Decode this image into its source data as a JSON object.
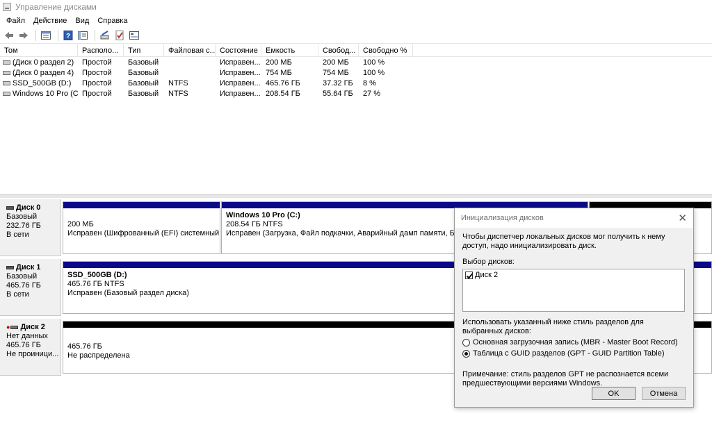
{
  "window": {
    "title": "Управление дисками"
  },
  "menu": [
    "Файл",
    "Действие",
    "Вид",
    "Справка"
  ],
  "toolbar": {
    "icons": [
      "back-arrow-icon",
      "forward-arrow-icon",
      "properties-icon",
      "help-icon",
      "console-icon",
      "connect-drive-icon",
      "check-icon",
      "settings-icon"
    ]
  },
  "volumes": {
    "columns": [
      "Том",
      "Располо...",
      "Тип",
      "Файловая с...",
      "Состояние",
      "Емкость",
      "Свобод...",
      "Свободно %"
    ],
    "rows": [
      [
        "(Диск 0 раздел 2)",
        "Простой",
        "Базовый",
        "",
        "Исправен...",
        "200 МБ",
        "200 МБ",
        "100 %"
      ],
      [
        "(Диск 0 раздел 4)",
        "Простой",
        "Базовый",
        "",
        "Исправен...",
        "754 МБ",
        "754 МБ",
        "100 %"
      ],
      [
        "SSD_500GB (D:)",
        "Простой",
        "Базовый",
        "NTFS",
        "Исправен...",
        "465.76 ГБ",
        "37.32 ГБ",
        "8 %"
      ],
      [
        "Windows 10 Pro (C:)",
        "Простой",
        "Базовый",
        "NTFS",
        "Исправен...",
        "208.54 ГБ",
        "55.64 ГБ",
        "27 %"
      ]
    ]
  },
  "disks": [
    {
      "name": "Диск 0",
      "type": "Базовый",
      "size": "232.76 ГБ",
      "status": "В сети",
      "partitions": [
        {
          "title": "",
          "line1": "200 МБ",
          "line2": "Исправен (Шифрованный (EFI) системный ра"
        },
        {
          "title": "Windows 10 Pro  (C:)",
          "line1": "208.54 ГБ NTFS",
          "line2": "Исправен (Загрузка, Файл подкачки, Аварийный дамп памяти, Базов"
        }
      ]
    },
    {
      "name": "Диск 1",
      "type": "Базовый",
      "size": "465.76 ГБ",
      "status": "В сети",
      "partitions": [
        {
          "title": "SSD_500GB  (D:)",
          "line1": "465.76 ГБ NTFS",
          "line2": "Исправен (Базовый раздел диска)"
        }
      ]
    },
    {
      "name": "Диск 2",
      "type": "Нет данных",
      "size": "465.76 ГБ",
      "status": "Не проиници...",
      "partitions": [
        {
          "title": "",
          "line1": "465.76 ГБ",
          "line2": "Не распределена"
        }
      ]
    }
  ],
  "dialog": {
    "title": "Инициализация дисков",
    "close": "✕",
    "description": "Чтобы диспетчер локальных дисков мог получить к нему доступ, надо инициализировать диск.",
    "select_label": "Выбор дисков:",
    "disk_item": "Диск 2",
    "style_label": "Использовать указанный ниже стиль разделов для выбранных дисков:",
    "option_mbr": "Основная загрузочная запись (MBR - Master Boot Record)",
    "option_gpt": "Таблица с GUID разделов (GPT - GUID Partition Table)",
    "selected_option": "gpt",
    "note": "Примечание: стиль разделов GPT не распознается всеми предшествующими версиями Windows.",
    "ok": "OK",
    "cancel": "Отмена"
  },
  "colors": {
    "primary_partition": "#0a0a88",
    "unallocated": "#000000",
    "dialog_bg": "#f0f0f0"
  }
}
